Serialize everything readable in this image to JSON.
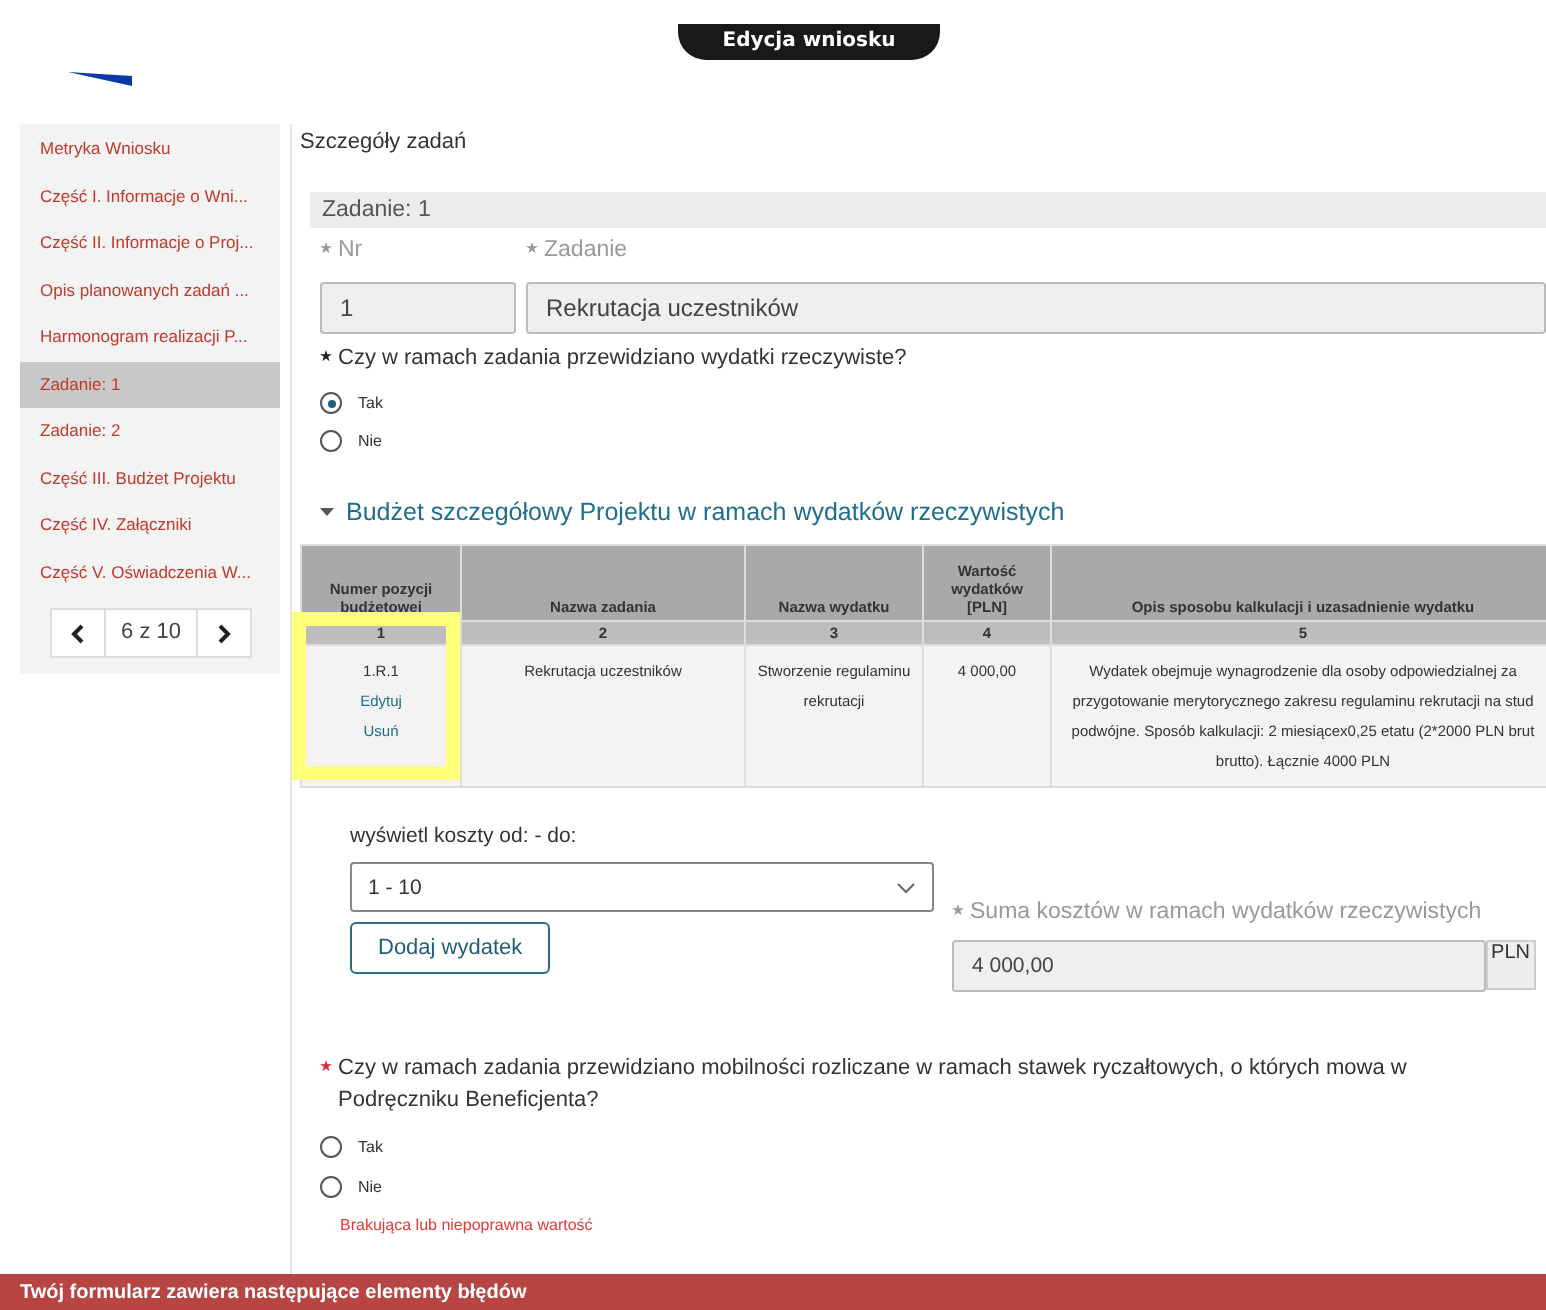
{
  "header": {
    "title": "Edycja wniosku"
  },
  "sidebar": {
    "items": [
      {
        "label": "Metryka Wniosku",
        "selected": false
      },
      {
        "label": "Część I. Informacje o Wni...",
        "selected": false
      },
      {
        "label": "Część II. Informacje o Proj...",
        "selected": false
      },
      {
        "label": "Opis planowanych zadań ...",
        "selected": false
      },
      {
        "label": "Harmonogram realizacji P...",
        "selected": false
      },
      {
        "label": "Zadanie: 1",
        "selected": true
      },
      {
        "label": "Zadanie: 2",
        "selected": false
      },
      {
        "label": "Część III. Budżet Projektu",
        "selected": false
      },
      {
        "label": "Część IV. Załączniki",
        "selected": false
      },
      {
        "label": "Część V. Oświadczenia W...",
        "selected": false
      }
    ],
    "pager": "6 z 10"
  },
  "main": {
    "title": "Szczegóły zadań",
    "task_header": "Zadanie: 1",
    "fields": [
      {
        "label": "Nr",
        "required": true,
        "value": "1"
      },
      {
        "label": "Zadanie",
        "required": true,
        "value": "Rekrutacja uczestników"
      }
    ],
    "question1": {
      "text": "Czy w ramach zadania przewidziano wydatki rzeczywiste?",
      "required": true,
      "options": [
        {
          "label": "Tak",
          "selected": true
        },
        {
          "label": "Nie",
          "selected": false
        }
      ]
    },
    "section": {
      "title": "Budżet szczegółowy Projektu w ramach wydatków rzeczywistych",
      "expanded": true
    },
    "table": {
      "columns": [
        {
          "label": "Numer pozycji budżetowej",
          "number": "1"
        },
        {
          "label": "Nazwa zadania",
          "number": "2"
        },
        {
          "label": "Nazwa wydatku",
          "number": "3"
        },
        {
          "label": "Wartość wydatków [PLN]",
          "number": "4"
        },
        {
          "label": "Opis sposobu kalkulacji i uzasadnienie wydatku",
          "number": "5"
        }
      ],
      "rows": [
        {
          "number": "1.R.1",
          "actions": [
            "Edytuj",
            "Usuń"
          ],
          "task": "Rekrutacja uczestników",
          "expense": "Stworzenie regulaminu rekrutacji",
          "value": "4 000,00",
          "description": [
            "Wydatek obejmuje wynagrodzenie dla osoby odpowiedzialnej za",
            "przygotowanie merytorycznego zakresu regulaminu rekrutacji na stud",
            "podwójne. Sposób kalkulacji: 2 miesiącex0,25 etatu (2*2000 PLN brut",
            "brutto). Łącznie 4000 PLN"
          ]
        }
      ]
    },
    "range": {
      "label": "wyświetl koszty od: - do:",
      "value": "1 - 10"
    },
    "add_button": "Dodaj wydatek",
    "sum": {
      "label": "Suma kosztów w ramach wydatków rzeczywistych",
      "required": true,
      "value": "4 000,00",
      "unit": "PLN"
    },
    "question2": {
      "text": "Czy w ramach zadania przewidziano mobilności rozliczane w ramach stawek ryczałtowych, o których mowa w Podręczniku Beneficjenta?",
      "required": true,
      "options": [
        {
          "label": "Tak",
          "selected": false
        },
        {
          "label": "Nie",
          "selected": false
        }
      ],
      "error": "Brakująca lub niepoprawna wartość"
    }
  },
  "error_bar": "Twój formularz zawiera następujące elementy błędów"
}
